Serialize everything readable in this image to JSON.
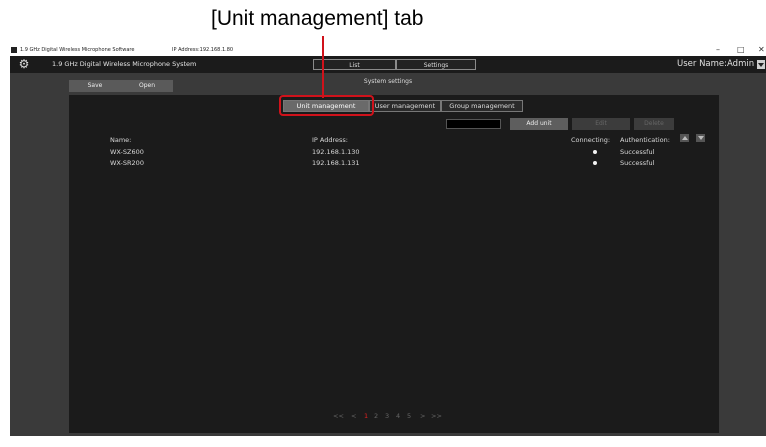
{
  "callout": {
    "label": "[Unit management] tab",
    "color": "#d0121b"
  },
  "titlebar": {
    "title": "1.9 GHz Digital Wireless Microphone Software",
    "ip": "IP Address:192.168.1.80",
    "minimize": "–",
    "maximize": "□",
    "close": "✕"
  },
  "header": {
    "system_name": "1.9 GHz Digital Wireless Microphone System",
    "tabs": [
      {
        "label": "List"
      },
      {
        "label": "Settings"
      }
    ],
    "user_name": "User Name:Admin"
  },
  "toolbar": {
    "save_label": "Save",
    "open_label": "Open"
  },
  "section_title": "System settings",
  "subtabs": [
    {
      "label": "Unit management",
      "active": true
    },
    {
      "label": "User management",
      "active": false
    },
    {
      "label": "Group management",
      "active": false
    }
  ],
  "actions": {
    "add_unit": "Add unit",
    "edit": "Edit",
    "delete": "Delete"
  },
  "table": {
    "headers": {
      "name": "Name:",
      "ip": "IP Address:",
      "connecting": "Connecting:",
      "authentication": "Authentication:"
    },
    "rows": [
      {
        "name": "WX-SZ600",
        "ip": "192.168.1.130",
        "connecting": true,
        "authentication": "Successful"
      },
      {
        "name": "WX-SR200",
        "ip": "192.168.1.131",
        "connecting": true,
        "authentication": "Successful"
      }
    ]
  },
  "pagination": {
    "first": "<<",
    "prev": "<",
    "pages": [
      "1",
      "2",
      "3",
      "4",
      "5"
    ],
    "current": "1",
    "next": ">",
    "last": ">>"
  },
  "icons": {
    "settings": "gear-icon",
    "sort_up": "triangle-up-icon",
    "sort_down": "triangle-down-icon",
    "user_menu": "chevron-down-icon"
  },
  "colors": {
    "app_bg": "#3a3a3a",
    "panel_bg": "#1b1b1b",
    "highlight": "#d0121b"
  }
}
